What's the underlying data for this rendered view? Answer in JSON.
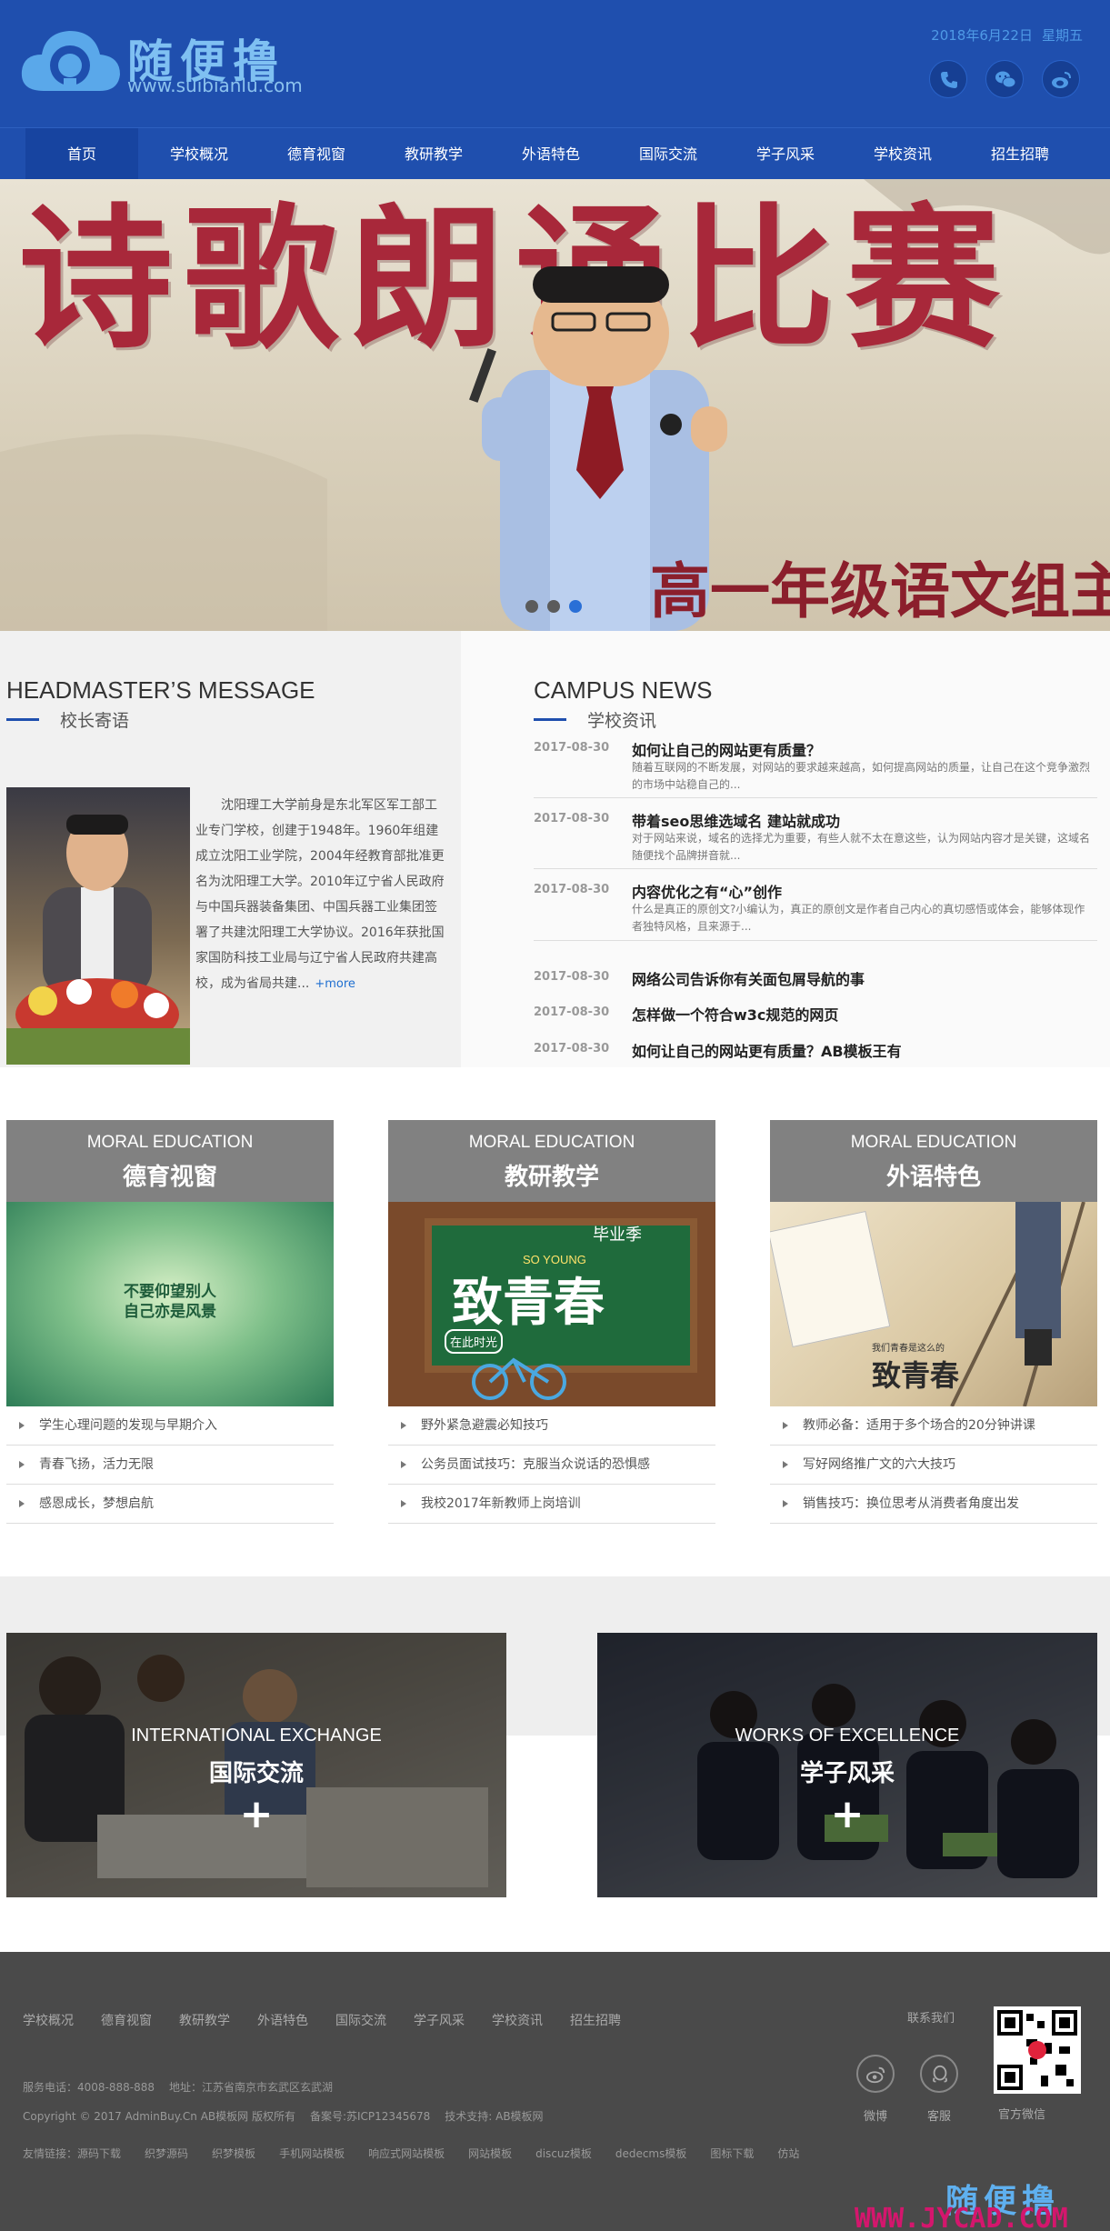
{
  "header": {
    "logo_text": "随便撸",
    "logo_url": "www.suibianlu.com",
    "date": "2018年6月22日",
    "weekday": "星期五",
    "social_icons": [
      "phone-icon",
      "wechat-icon",
      "weibo-icon"
    ],
    "colors": {
      "primary": "#1f4fae",
      "accent": "#7fc0f2"
    }
  },
  "nav": {
    "items": [
      {
        "label": "首页",
        "active": true
      },
      {
        "label": "学校概况"
      },
      {
        "label": "德育视窗"
      },
      {
        "label": "教研教学"
      },
      {
        "label": "外语特色"
      },
      {
        "label": "国际交流"
      },
      {
        "label": "学子风采"
      },
      {
        "label": "学校资讯"
      },
      {
        "label": "招生招聘"
      }
    ]
  },
  "banner": {
    "title": "诗歌朗诵比赛",
    "subtitle": "高一年级语文组主",
    "slides": 3,
    "active_slide": 3
  },
  "headmaster": {
    "title_en": "HEADMASTER’S MESSAGE",
    "title_cn": "校长寄语",
    "text": "沈阳理工大学前身是东北军区军工部工业专门学校，创建于1948年。1960年组建成立沈阳工业学院，2004年经教育部批准更名为沈阳理工大学。2010年辽宁省人民政府与中国兵器装备集团、中国兵器工业集团签署了共建沈阳理工大学协议。2016年获批国家国防科技工业局与辽宁省人民政府共建高校，成为省局共建...",
    "more": "+more"
  },
  "news": {
    "title_en": "CAMPUS NEWS",
    "title_cn": "学校资讯",
    "featured": [
      {
        "date": "2017-08-30",
        "title": "如何让自己的网站更有质量？",
        "desc": "随着互联网的不断发展，对网站的要求越来越高，如何提高网站的质量，让自己在这个竞争激烈的市场中站稳自己的..."
      },
      {
        "date": "2017-08-30",
        "title": "带着seo思维选域名 建站就成功",
        "desc": "对于网站来说，域名的选择尤为重要，有些人就不太在意这些，认为网站内容才是关键，这域名随便找个品牌拼音就..."
      },
      {
        "date": "2017-08-30",
        "title": "内容优化之有“心”创作",
        "desc": "什么是真正的原创文?小编认为，真正的原创文是作者自己内心的真切感悟或体会，能够体现作者独特风格，且来源于..."
      }
    ],
    "list": [
      {
        "date": "2017-08-30",
        "title": "网络公司告诉你有关面包屑导航的事"
      },
      {
        "date": "2017-08-30",
        "title": "怎样做一个符合w3c规范的网页"
      },
      {
        "date": "2017-08-30",
        "title": "如何让自己的网站更有质量？AB模板王有"
      }
    ]
  },
  "cards": [
    {
      "en": "MORAL EDUCATION",
      "cn": "德育视窗",
      "image_text": [
        "不要仰望别人",
        "自己亦是风景"
      ],
      "items": [
        "学生心理问题的发现与早期介入",
        "青春飞扬，活力无限",
        "感恩成长，梦想启航"
      ]
    },
    {
      "en": "MORAL EDUCATION",
      "cn": "教研教学",
      "image_text": [
        "毕业季",
        "SO YOUNG",
        "致青春",
        "在此时光"
      ],
      "items": [
        "野外紧急避震必知技巧",
        "公务员面试技巧：克服当众说话的恐惧感",
        "我校2017年新教师上岗培训"
      ]
    },
    {
      "en": "MORAL EDUCATION",
      "cn": "外语特色",
      "image_text": [
        "致青春",
        "我们青春是这么的"
      ],
      "items": [
        "教师必备：适用于多个场合的20分钟讲课",
        "写好网络推广文的六大技巧",
        "销售技巧：换位思考从消费者角度出发"
      ]
    }
  ],
  "features": [
    {
      "en": "INTERNATIONAL EXCHANGE",
      "cn": "国际交流",
      "plus": "+"
    },
    {
      "en": "WORKS OF EXCELLENCE",
      "cn": "学子风采",
      "plus": "+"
    }
  ],
  "footer": {
    "links": [
      "学校概况",
      "德育视窗",
      "教研教学",
      "外语特色",
      "国际交流",
      "学子风采",
      "学校资讯",
      "招生招聘"
    ],
    "phone": "服务电话：4008-888-888",
    "address": "地址：江苏省南京市玄武区玄武湖",
    "copyright": "Copyright © 2017 AdminBuy.Cn AB模板网 版权所有",
    "icp": "备案号:苏ICP12345678",
    "support": "技术支持: AB模板网",
    "friend_label": "友情链接：",
    "friends": [
      "源码下载",
      "织梦源码",
      "织梦模板",
      "手机网站模板",
      "响应式网站模板",
      "网站模板",
      "discuz模板",
      "dedecms模板",
      "图标下载",
      "仿站"
    ],
    "contact_label": "联系我们",
    "weibo_label": "微博",
    "service_label": "客服",
    "qr_label": "官方微信",
    "logo_text": "随便撸",
    "watermark": "WWW.JYCAD.COM"
  }
}
